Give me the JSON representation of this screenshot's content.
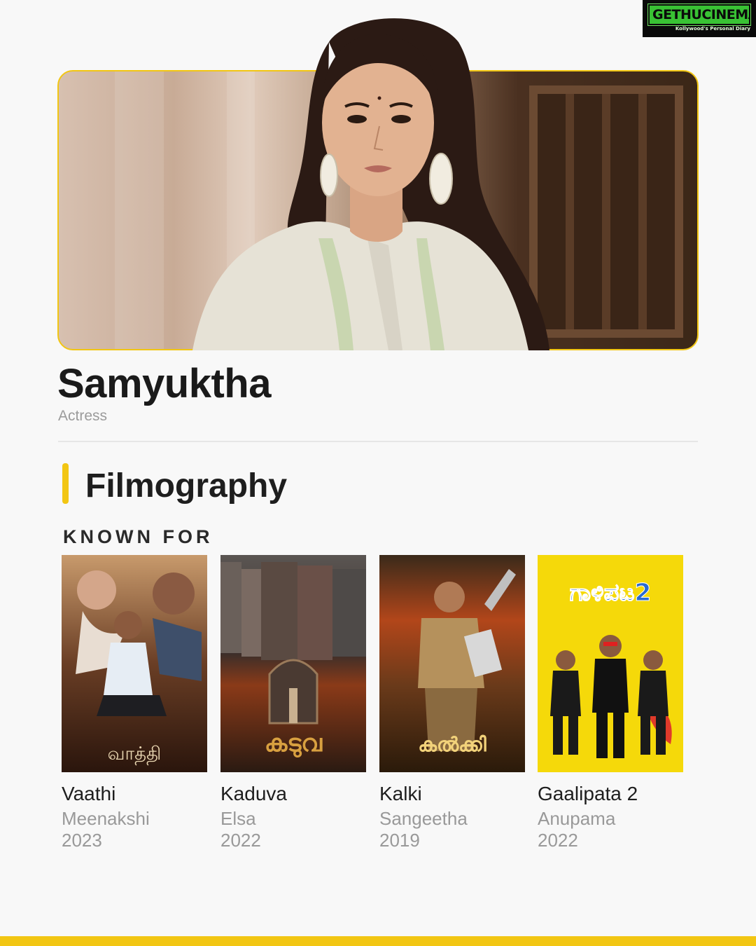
{
  "watermark": {
    "name": "GETHUCINEMA",
    "tagline": "Kollywood's Personal Diary"
  },
  "profile": {
    "name": "Samyuktha",
    "role": "Actress"
  },
  "section": {
    "title": "Filmography",
    "subtitle": "KNOWN FOR"
  },
  "films": [
    {
      "title": "Vaathi",
      "role": "Meenakshi",
      "year": "2023",
      "poster_text": "வாத்தி",
      "poster_bg": "#3a2418"
    },
    {
      "title": "Kaduva",
      "role": "Elsa",
      "year": "2022",
      "poster_text": "കടുവ",
      "poster_bg": "#2a1a14"
    },
    {
      "title": "Kalki",
      "role": "Sangeetha",
      "year": "2019",
      "poster_text": "കൽക്കി",
      "poster_bg": "#3b2410"
    },
    {
      "title": "Gaalipata 2",
      "role": "Anupama",
      "year": "2022",
      "poster_text": "ಗಾಳಿಪಟ2",
      "poster_bg": "#f5d90a"
    }
  ],
  "colors": {
    "accent": "#f2c613",
    "background": "#f8f8f8",
    "muted_text": "#999999"
  }
}
